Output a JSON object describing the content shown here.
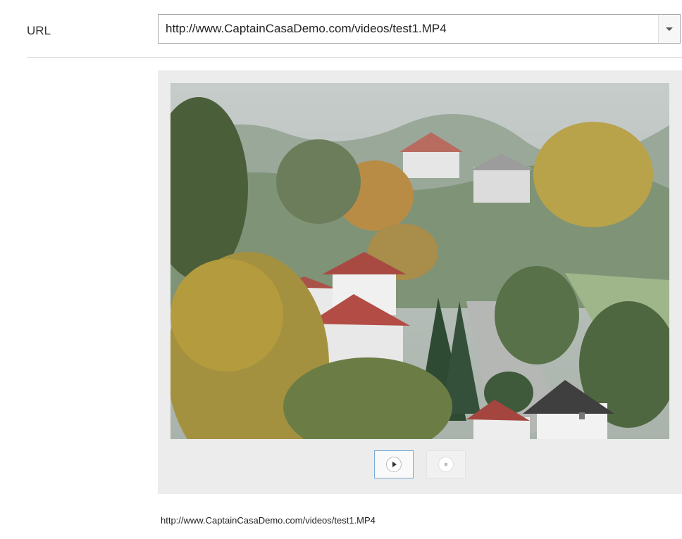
{
  "url_field": {
    "label": "URL",
    "value": "http://www.CaptainCasaDemo.com/videos/test1.MP4"
  },
  "video_player": {
    "play_icon": "play-icon",
    "stop_icon": "stop-icon"
  },
  "source_caption": "http://www.CaptainCasaDemo.com/videos/test1.MP4",
  "colors": {
    "focus_border": "#76a9d6",
    "panel_bg": "#ececec"
  }
}
